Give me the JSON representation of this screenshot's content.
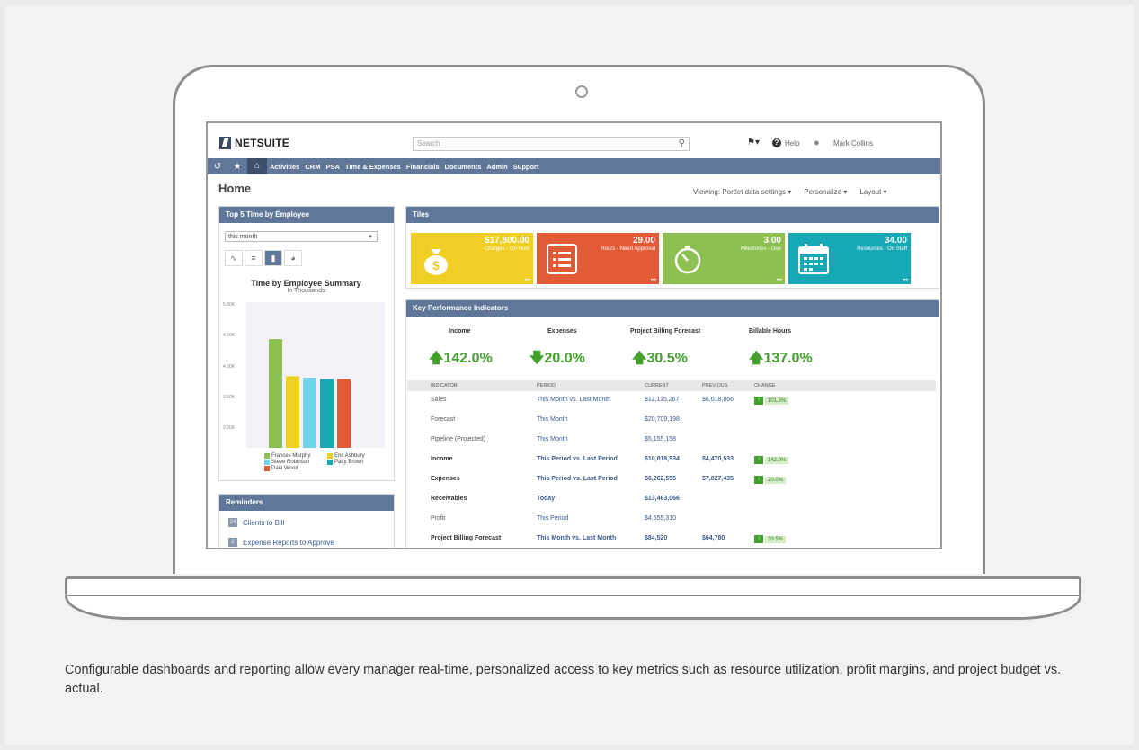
{
  "app": {
    "logo_text": "NETSUITE",
    "search_placeholder": "Search",
    "help_label": "Help",
    "user_name": "Mark Collins"
  },
  "nav": {
    "items": [
      "Activities",
      "CRM",
      "PSA",
      "Time & Expenses",
      "Financials",
      "Documents",
      "Admin",
      "Support"
    ]
  },
  "page": {
    "title": "Home",
    "links": [
      "Viewing: Portlet data settings ▾",
      "Personalize ▾",
      "Layout ▾"
    ]
  },
  "top_time": {
    "title": "Top 5 Time by Employee",
    "filter": "this month",
    "chart_title": "Time by Employee Summary",
    "chart_subtitle": "In Thousands"
  },
  "chart_data": {
    "type": "bar",
    "title": "Time by Employee Summary",
    "subtitle": "In Thousands",
    "y_ticks": [
      "5.00K",
      "4.50K",
      "4.00K",
      "3.50K",
      "3.00K"
    ],
    "ylim": [
      3.0,
      5.0
    ],
    "series": [
      {
        "name": "Frances Murphy",
        "value": 4.55,
        "color": "#8cc152"
      },
      {
        "name": "Eric Ashbury",
        "value": 4.02,
        "color": "#f0cf25"
      },
      {
        "name": "Steve Robinson",
        "value": 4.0,
        "color": "#72d3ec"
      },
      {
        "name": "Patty Brown",
        "value": 3.98,
        "color": "#17a8b5"
      },
      {
        "name": "Dale Wood",
        "value": 3.98,
        "color": "#e35a37"
      }
    ]
  },
  "reminders": {
    "title": "Reminders",
    "items": [
      {
        "count": "24",
        "label": "Clients to Bill"
      },
      {
        "count": "2",
        "label": "Expense Reports to Approve"
      }
    ]
  },
  "tiles": {
    "title": "Tiles",
    "items": [
      {
        "value": "$17,800.00",
        "label": "Charges - On Hold",
        "color": "#f0cf25",
        "icon": "money-bag-icon"
      },
      {
        "value": "29.00",
        "label": "Hours - Need Approval",
        "color": "#e35a37",
        "icon": "list-icon"
      },
      {
        "value": "3.00",
        "label": "Milestones - Due",
        "color": "#8cc152",
        "icon": "stopwatch-icon"
      },
      {
        "value": "34.00",
        "label": "Resources - On Staff",
        "color": "#17a8b5",
        "icon": "calendar-icon"
      }
    ]
  },
  "kpi": {
    "title": "Key Performance Indicators",
    "summary": [
      {
        "label": "Income",
        "value": "142.0%",
        "direction": "up"
      },
      {
        "label": "Expenses",
        "value": "20.0%",
        "direction": "down"
      },
      {
        "label": "Project Billing Forecast",
        "value": "30.5%",
        "direction": "up"
      },
      {
        "label": "Billable Hours",
        "value": "137.0%",
        "direction": "up"
      }
    ],
    "columns": [
      "INDICATOR",
      "PERIOD",
      "CURRENT",
      "PREVIOUS",
      "CHANGE"
    ],
    "rows": [
      {
        "indicator": "Sales",
        "period": "This Month vs. Last Month",
        "current": "$12,115,267",
        "previous": "$6,018,866",
        "change": "101.3%",
        "bold": false
      },
      {
        "indicator": "Forecast",
        "period": "This Month",
        "current": "$20,709,198",
        "previous": "",
        "change": "",
        "bold": false
      },
      {
        "indicator": "Pipeline (Projected)",
        "period": "This Month",
        "current": "$5,155,158",
        "previous": "",
        "change": "",
        "bold": false
      },
      {
        "indicator": "Income",
        "period": "This Period vs. Last Period",
        "current": "$10,818,534",
        "previous": "$4,470,533",
        "change": "142.0%",
        "bold": true
      },
      {
        "indicator": "Expenses",
        "period": "This Period vs. Last Period",
        "current": "$6,262,555",
        "previous": "$7,827,435",
        "change": "20.0%",
        "bold": true
      },
      {
        "indicator": "Receivables",
        "period": "Today",
        "current": "$13,463,066",
        "previous": "",
        "change": "",
        "bold": true
      },
      {
        "indicator": "Profit",
        "period": "This Period",
        "current": "$4,555,310",
        "previous": "",
        "change": "",
        "bold": false
      },
      {
        "indicator": "Project Billing Forecast",
        "period": "This Month vs. Last Month",
        "current": "$84,520",
        "previous": "$64,780",
        "change": "30.5%",
        "bold": true
      }
    ]
  },
  "caption": "Configurable dashboards and reporting       allow every manager real-time, personalized access to key metrics such as resource utilization, profit margins, and project budget vs. actual."
}
